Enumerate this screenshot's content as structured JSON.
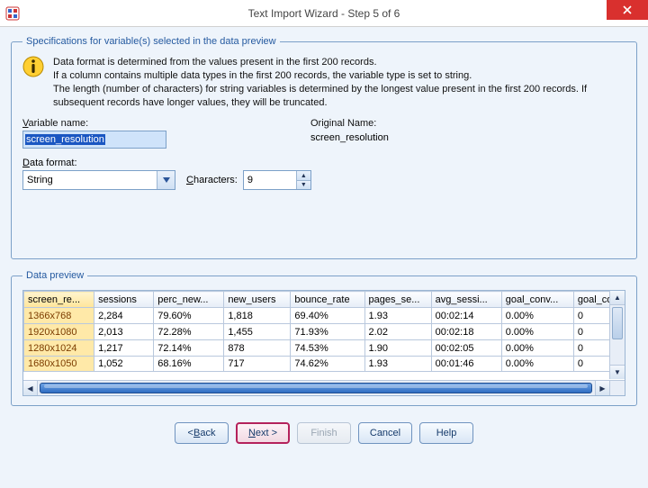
{
  "window": {
    "title": "Text Import Wizard - Step 5 of 6"
  },
  "spec_group": {
    "legend": "Specifications for variable(s) selected in the data preview",
    "info": "Data format is determined from the values present in the first 200 records.\nIf a column contains multiple data types in the first 200 records, the variable type is set to string.\nThe length (number of characters) for string variables is determined by the longest value present in the first 200 records. If subsequent records have longer values, they will be truncated.",
    "variable_name_label": "Variable name:",
    "variable_name_hotkey": "V",
    "variable_name_value": "screen_resolution",
    "original_name_label": "Original Name:",
    "original_name_value": "screen_resolution",
    "data_format_label": "Data format:",
    "data_format_hotkey": "D",
    "data_format_value": "String",
    "characters_label": "Characters:",
    "characters_hotkey": "C",
    "characters_value": "9"
  },
  "preview_group": {
    "legend": "Data preview",
    "columns": [
      "screen_re...",
      "sessions",
      "perc_new...",
      "new_users",
      "bounce_rate",
      "pages_se...",
      "avg_sessi...",
      "goal_conv...",
      "goal_co"
    ],
    "rows": [
      [
        "1366x768",
        "2,284",
        "79.60%",
        "1,818",
        "69.40%",
        "1.93",
        "00:02:14",
        "0.00%",
        "0"
      ],
      [
        "1920x1080",
        "2,013",
        "72.28%",
        "1,455",
        "71.93%",
        "2.02",
        "00:02:18",
        "0.00%",
        "0"
      ],
      [
        "1280x1024",
        "1,217",
        "72.14%",
        "878",
        "74.53%",
        "1.90",
        "00:02:05",
        "0.00%",
        "0"
      ],
      [
        "1680x1050",
        "1,052",
        "68.16%",
        "717",
        "74.62%",
        "1.93",
        "00:01:46",
        "0.00%",
        "0"
      ]
    ]
  },
  "buttons": {
    "back": "< Back",
    "back_hot": "B",
    "next": "Next >",
    "next_hot": "N",
    "finish": "Finish",
    "cancel": "Cancel",
    "help": "Help"
  }
}
